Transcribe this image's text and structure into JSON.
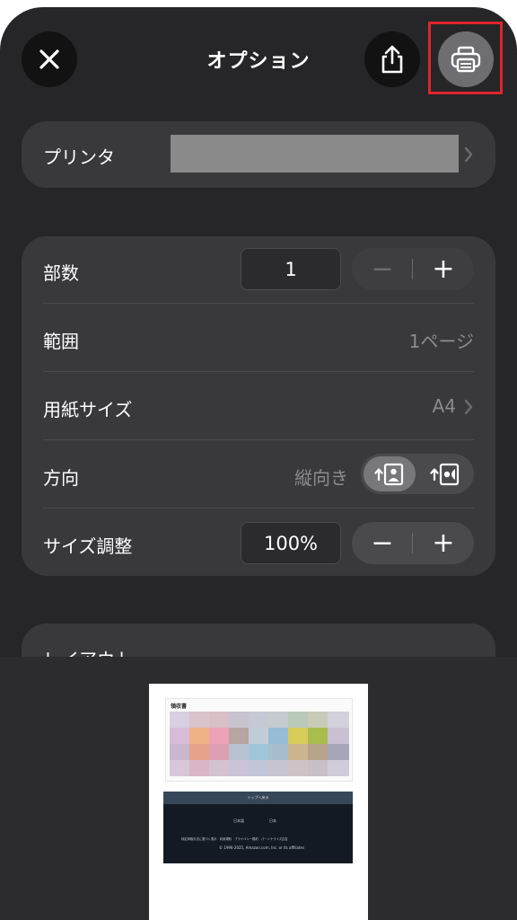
{
  "header": {
    "close_icon": "close-icon",
    "title": "オプション",
    "share_icon": "share-icon",
    "print_icon": "printer-icon"
  },
  "printer": {
    "label": "プリンタ",
    "value": "",
    "chevron_icon": "chevron-right-icon"
  },
  "settings": {
    "copies": {
      "label": "部数",
      "value": "1",
      "minus": "−",
      "plus": "+"
    },
    "range": {
      "label": "範囲",
      "value": "1ページ"
    },
    "paper": {
      "label": "用紙サイズ",
      "value": "A4"
    },
    "orientation": {
      "label": "方向",
      "value": "縦向き",
      "options": [
        "portrait-icon",
        "landscape-icon"
      ],
      "selected": "portrait"
    },
    "scale": {
      "label": "サイズ調整",
      "value": "100%",
      "minus": "−",
      "plus": "+"
    }
  },
  "layout": {
    "label": "レイアウト"
  },
  "preview": {
    "doc_title": "領収書",
    "footer": {
      "back_to_top": "トップへ戻る",
      "lang": "日本語",
      "region": "日本",
      "links": "特定商取引法に基づく表示　利用規約　プライバシー規約　パーソナライズ広告",
      "copyright": "© 1996-2025, Amazon.com, Inc. or its affiliates"
    }
  },
  "colors": {
    "sheet_bg": "#262628",
    "card_bg": "#39393c",
    "highlight": "#e0242b"
  }
}
